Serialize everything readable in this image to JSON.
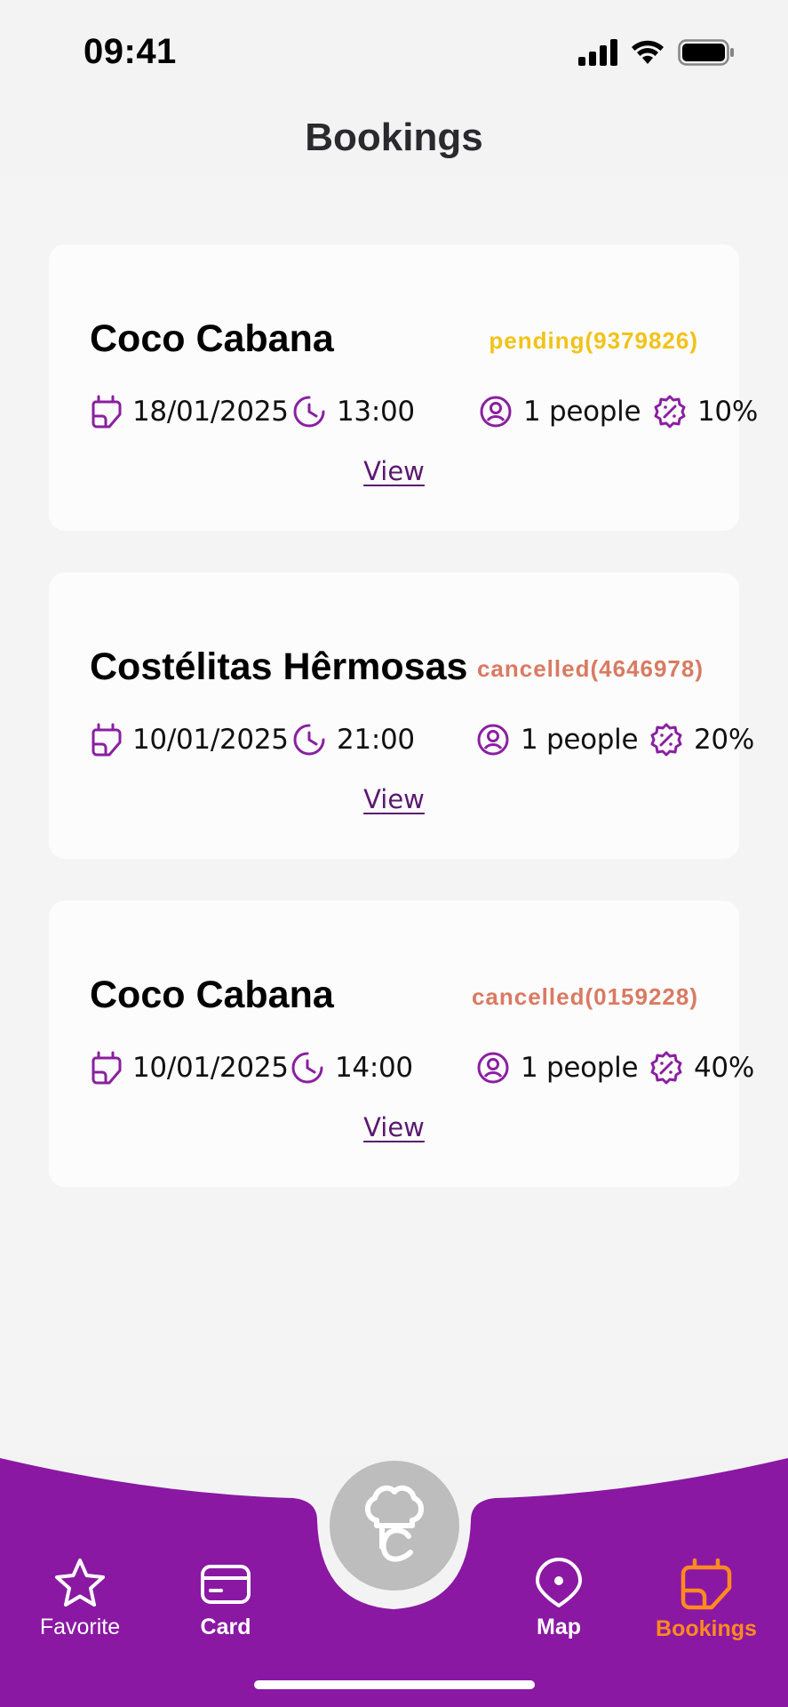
{
  "status_bar": {
    "time": "09:41"
  },
  "header": {
    "title": "Bookings"
  },
  "bookings": [
    {
      "name": "Coco Cabana",
      "status": "pending(9379826)",
      "status_color": "#F2C219",
      "date": "18/01/2025",
      "time": "13:00",
      "people": "1 people",
      "discount": "10%",
      "view_label": "View"
    },
    {
      "name": "Costélitas Hêrmosas",
      "status": "cancelled(4646978)",
      "status_color": "#D97A63",
      "date": "10/01/2025",
      "time": "21:00",
      "people": "1 people",
      "discount": "20%",
      "view_label": "View"
    },
    {
      "name": "Coco Cabana",
      "status": "cancelled(0159228)",
      "status_color": "#D97A63",
      "date": "10/01/2025",
      "time": "14:00",
      "people": "1 people",
      "discount": "40%",
      "view_label": "View"
    }
  ],
  "nav": {
    "items": [
      {
        "label": "Favorite",
        "icon": "star-icon"
      },
      {
        "label": "Card",
        "icon": "card-icon"
      },
      {
        "label": "Map",
        "icon": "map-pin-icon"
      },
      {
        "label": "Bookings",
        "icon": "bookings-icon",
        "active": true
      }
    ],
    "center_icon": "chef-hat-icon"
  },
  "colors": {
    "accent": "#8A18A3",
    "active": "#FF8A1F",
    "icon_purple": "#8A1FA1"
  }
}
